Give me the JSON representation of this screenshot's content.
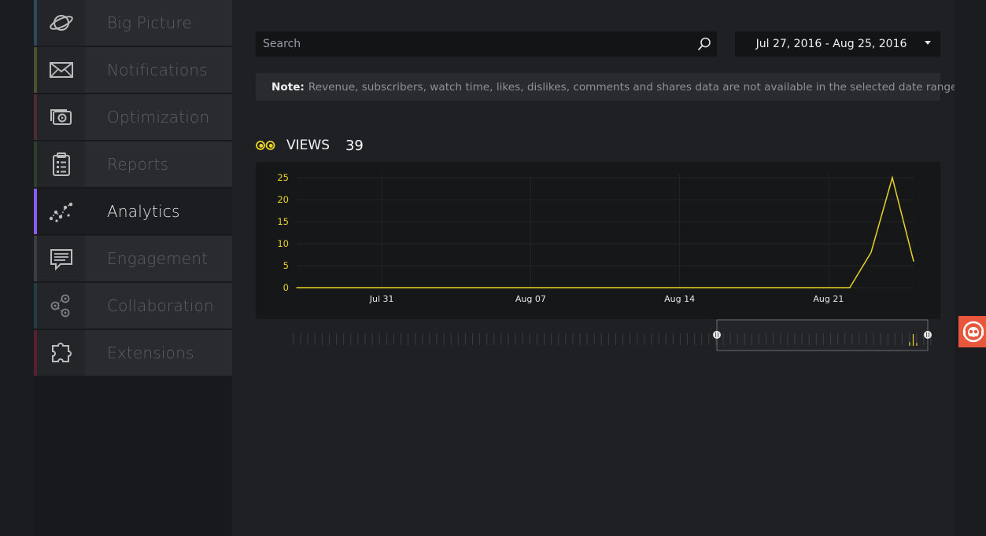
{
  "sidebar": {
    "items": [
      {
        "label": "Big Picture",
        "icon": "planet-icon",
        "accent": "#2d4a5c",
        "active": false
      },
      {
        "label": "Notifications",
        "icon": "envelope-icon",
        "accent": "#4a5130",
        "active": false
      },
      {
        "label": "Optimization",
        "icon": "video-camera-icon",
        "accent": "#4d2e30",
        "active": false
      },
      {
        "label": "Reports",
        "icon": "clipboard-icon",
        "accent": "#2c3f2d",
        "active": false
      },
      {
        "label": "Analytics",
        "icon": "scatter-chart-icon",
        "accent": "#8a5cf5",
        "active": true
      },
      {
        "label": "Engagement",
        "icon": "speech-bubble-icon",
        "accent": "#3c3d40",
        "active": false
      },
      {
        "label": "Collaboration",
        "icon": "people-network-icon",
        "accent": "#1f3f44",
        "active": false
      },
      {
        "label": "Extensions",
        "icon": "puzzle-piece-icon",
        "accent": "#5a1f33",
        "active": false
      }
    ]
  },
  "search": {
    "placeholder": "Search"
  },
  "date_range": {
    "value": "Jul 27, 2016 - Aug 25, 2016"
  },
  "note": {
    "prefix": "Note:",
    "text": "Revenue, subscribers, watch time, likes, dislikes, comments and shares data are not available in the selected date range."
  },
  "views": {
    "label": "VIEWS",
    "count": "39"
  },
  "colors": {
    "accent_yellow": "#e8d325",
    "active_purple": "#8a5cf5",
    "help_orange": "#e8573c"
  },
  "chart_data": {
    "type": "line",
    "x": [
      "2016-07-27",
      "2016-07-28",
      "2016-07-29",
      "2016-07-30",
      "2016-07-31",
      "2016-08-01",
      "2016-08-02",
      "2016-08-03",
      "2016-08-04",
      "2016-08-05",
      "2016-08-06",
      "2016-08-07",
      "2016-08-08",
      "2016-08-09",
      "2016-08-10",
      "2016-08-11",
      "2016-08-12",
      "2016-08-13",
      "2016-08-14",
      "2016-08-15",
      "2016-08-16",
      "2016-08-17",
      "2016-08-18",
      "2016-08-19",
      "2016-08-20",
      "2016-08-21",
      "2016-08-22",
      "2016-08-23",
      "2016-08-24",
      "2016-08-25"
    ],
    "series": [
      {
        "values": [
          0,
          0,
          0,
          0,
          0,
          0,
          0,
          0,
          0,
          0,
          0,
          0,
          0,
          0,
          0,
          0,
          0,
          0,
          0,
          0,
          0,
          0,
          0,
          0,
          0,
          0,
          0,
          8,
          25,
          6
        ]
      }
    ],
    "x_ticks": [
      "Jul 31",
      "Aug 07",
      "Aug 14",
      "Aug 21"
    ],
    "x_tick_dates": [
      "2016-07-31",
      "2016-08-07",
      "2016-08-14",
      "2016-08-21"
    ],
    "y_ticks": [
      "0",
      "5",
      "10",
      "15",
      "20",
      "25"
    ],
    "ylim": [
      0,
      25
    ],
    "grid": true,
    "line_color": "#e8d325"
  }
}
